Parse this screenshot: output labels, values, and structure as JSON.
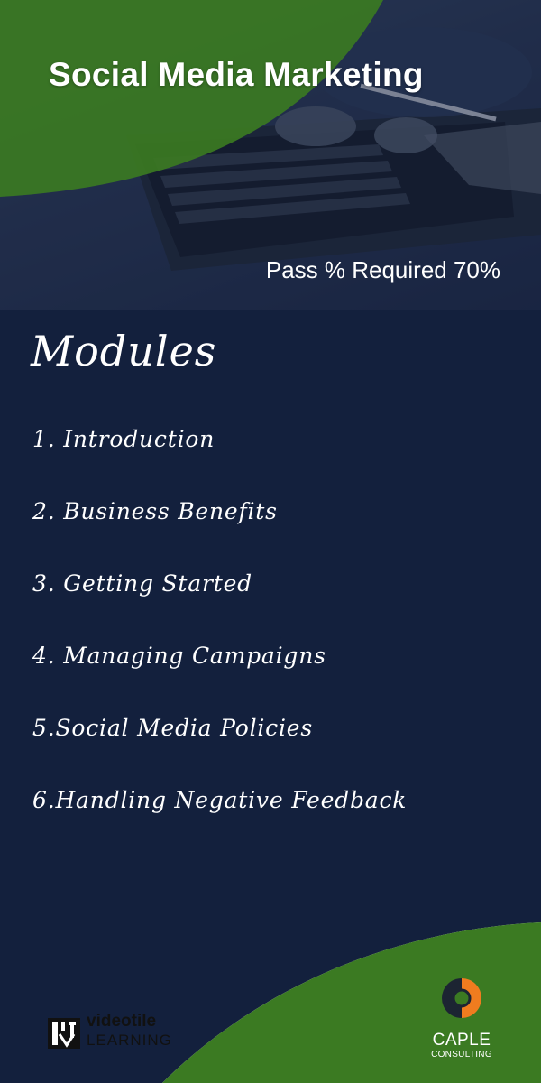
{
  "header": {
    "title": "Social Media Marketing",
    "pass_required": "Pass % Required 70%"
  },
  "modules": {
    "heading": "Modules",
    "items": [
      "1. Introduction",
      "2. Business Benefits",
      "3. Getting Started",
      "4. Managing Campaigns",
      "5.Social Media Policies",
      "6.Handling Negative Feedback"
    ]
  },
  "footer": {
    "videotile_name": "videotile",
    "videotile_sub": "LEARNING",
    "caple_name": "CAPLE",
    "caple_sub": "CONSULTING"
  },
  "colors": {
    "navy": "#13203d",
    "green": "#3b7a22",
    "orange": "#f07c1f"
  }
}
